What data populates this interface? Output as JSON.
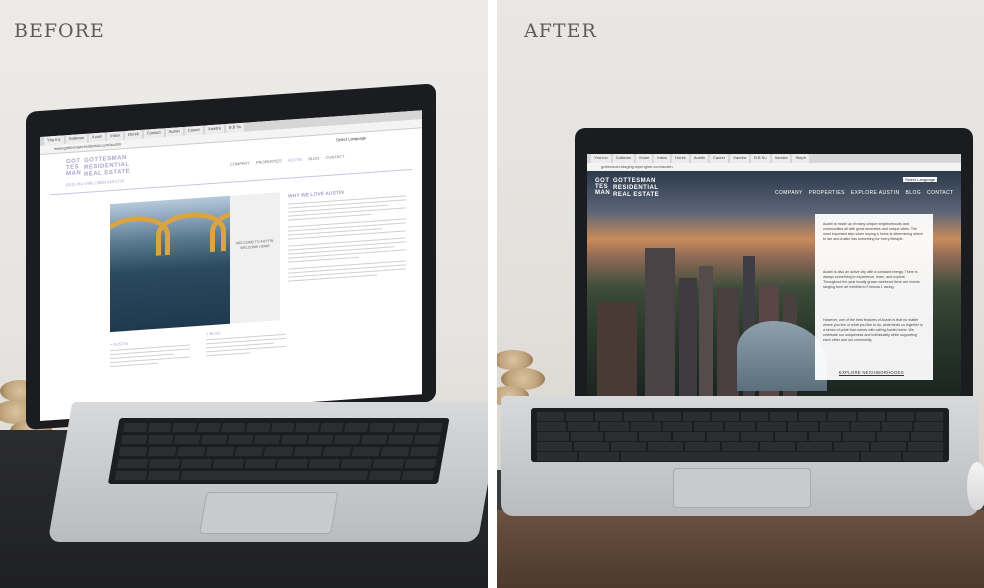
{
  "labels": {
    "before": "BEFORE",
    "after": "AFTER"
  },
  "browser": {
    "tabs": [
      "Yha Inc",
      "Gottman",
      "Xoom",
      "Inbox",
      "Derek",
      "Contact",
      "Austin",
      "Career",
      "Xandra",
      "B.B Su",
      "Xandra",
      "Steph"
    ],
    "before_url": "www.gottesmanresidential.com/austin",
    "after_url": "gottesman-staging.wpengine.com/austin"
  },
  "before_site": {
    "logo_mark": [
      "GOT",
      "TES",
      "MAN"
    ],
    "logo_text": [
      "GOTTESMAN",
      "RESIDENTIAL",
      "REAL ESTATE"
    ],
    "phone": "(512) 451-1466 | (888) 428-1736",
    "select_language": "Select Language",
    "nav": [
      "COMPANY",
      "PROPERTIES",
      "AUSTIN",
      "BLOG",
      "CONTACT"
    ],
    "active_nav": "AUSTIN",
    "heading": "WHY WE LOVE AUSTIN",
    "side_caption": "WELCOME TO AUSTIN, WELCOME HOME",
    "sub_austin": "+ AUSTIN",
    "sub_blog": "+ BLOG"
  },
  "after_site": {
    "logo_mark": [
      "GOT",
      "TES",
      "MAN"
    ],
    "logo_text": [
      "GOTTESMAN",
      "RESIDENTIAL",
      "REAL ESTATE"
    ],
    "select_language": "Select Language",
    "nav": [
      "COMPANY",
      "PROPERTIES",
      "EXPLORE AUSTIN",
      "BLOG",
      "CONTACT"
    ],
    "card_paragraphs": [
      "Austin is made up of many unique neighborhoods and communities all with great amenities and unique vibes. The most important step when buying a home is determining where to live and Austin has something for every lifestyle.",
      "Austin is also an active city with a constant energy. There is always something to experience, learn, and explore. Throughout the year locally-grown weekend there are events ranging from art exhibits to Formula 1 racing.",
      "However, one of the best features of Austin is that no matter where you live or what you like to do, what binds us together is a sense of pride that comes with calling Austin home. We celebrate our uniqueness and individuality while supporting each other and our community."
    ],
    "card_link": "EXPLORE NEIGHBORHOODS"
  }
}
